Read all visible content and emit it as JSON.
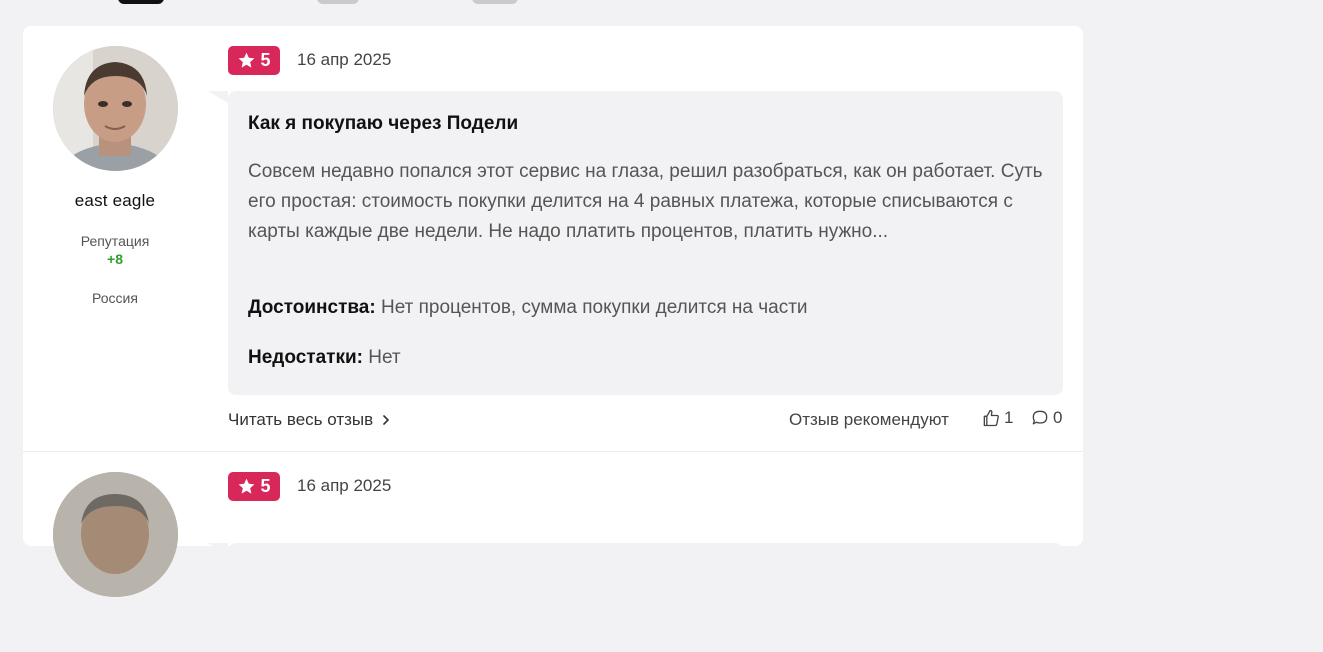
{
  "colors": {
    "rating_badge": "#d8285a",
    "reputation_positive": "#2f9e2f",
    "bubble_bg": "#f2f2f4",
    "page_bg": "#f2f2f4"
  },
  "reviews": [
    {
      "author": {
        "name": "east eagle",
        "reputation_label": "Репутация",
        "reputation_value": "+8",
        "country": "Россия",
        "avatar_icon": "user-photo"
      },
      "rating": "5",
      "rating_icon": "star-icon",
      "date": "16 апр 2025",
      "title": "Как я покупаю через Подели",
      "text": "Совсем недавно попался этот сервис на глаза, решил разобраться, как он работает. Суть его простая: стоимость покупки делится на 4 равных платежа, которые списываются с карты каждые две недели. Не надо платить процентов, платить нужно...",
      "pros_label": "Достоинства:",
      "pros": "Нет процентов, сумма покупки делится на части",
      "cons_label": "Недостатки:",
      "cons": "Нет",
      "read_more": "Читать весь отзыв",
      "recommend_label": "Отзыв рекомендуют",
      "likes": "1",
      "comments": "0"
    },
    {
      "author": {
        "avatar_icon": "user-photo"
      },
      "rating": "5",
      "rating_icon": "star-icon",
      "date": "16 апр 2025"
    }
  ]
}
